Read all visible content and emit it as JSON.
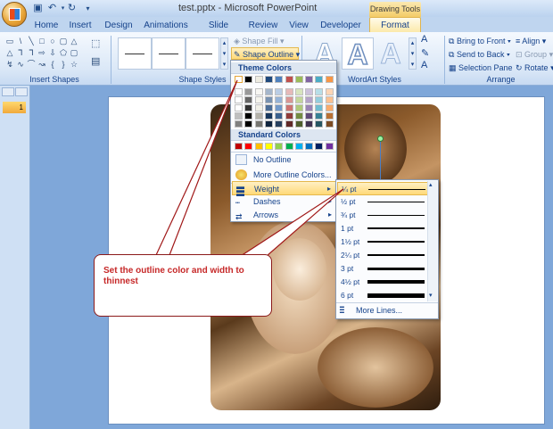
{
  "window": {
    "title": "test.pptx - Microsoft PowerPoint",
    "context_tab": "Drawing Tools"
  },
  "tabs": [
    "Home",
    "Insert",
    "Design",
    "Animations",
    "Slide Show",
    "Review",
    "View",
    "Developer"
  ],
  "active_tab": "Format",
  "ribbon": {
    "shape_fill": "Shape Fill",
    "shape_outline": "Shape Outline",
    "bring_to_front": "Bring to Front",
    "send_to_back": "Send to Back",
    "selection_pane": "Selection Pane",
    "align": "Align",
    "group": "Group",
    "rotate": "Rotate",
    "groups": {
      "insert_shapes": "Insert Shapes",
      "shape_styles": "Shape Styles",
      "wordart_styles": "WordArt Styles",
      "arrange": "Arrange"
    }
  },
  "thumbnail_number": "1",
  "outline_menu": {
    "theme_colors": "Theme Colors",
    "standard_colors": "Standard Colors",
    "no_outline": "No Outline",
    "more_colors": "More Outline Colors...",
    "weight": "Weight",
    "dashes": "Dashes",
    "arrows": "Arrows",
    "theme_swatches": [
      "#ffffff",
      "#000000",
      "#eeece1",
      "#1f497d",
      "#4f81bd",
      "#c0504d",
      "#9bbb59",
      "#8064a2",
      "#4bacc6",
      "#f79646"
    ],
    "standard_swatches": [
      "#c00000",
      "#ff0000",
      "#ffc000",
      "#ffff00",
      "#92d050",
      "#00b050",
      "#00b0f0",
      "#0070c0",
      "#002060",
      "#7030a0"
    ]
  },
  "weight_menu": {
    "options": [
      "¼ pt",
      "½ pt",
      "¾ pt",
      "1 pt",
      "1½ pt",
      "2¼ pt",
      "3 pt",
      "4½ pt",
      "6 pt"
    ],
    "selected": "¼ pt",
    "more_lines": "More Lines..."
  },
  "callout": {
    "text": "Set the outline color and width to thinnest"
  },
  "colors": {
    "accent": "#ffd978",
    "callout_text": "#c62828",
    "ribbon_text": "#15428b"
  }
}
